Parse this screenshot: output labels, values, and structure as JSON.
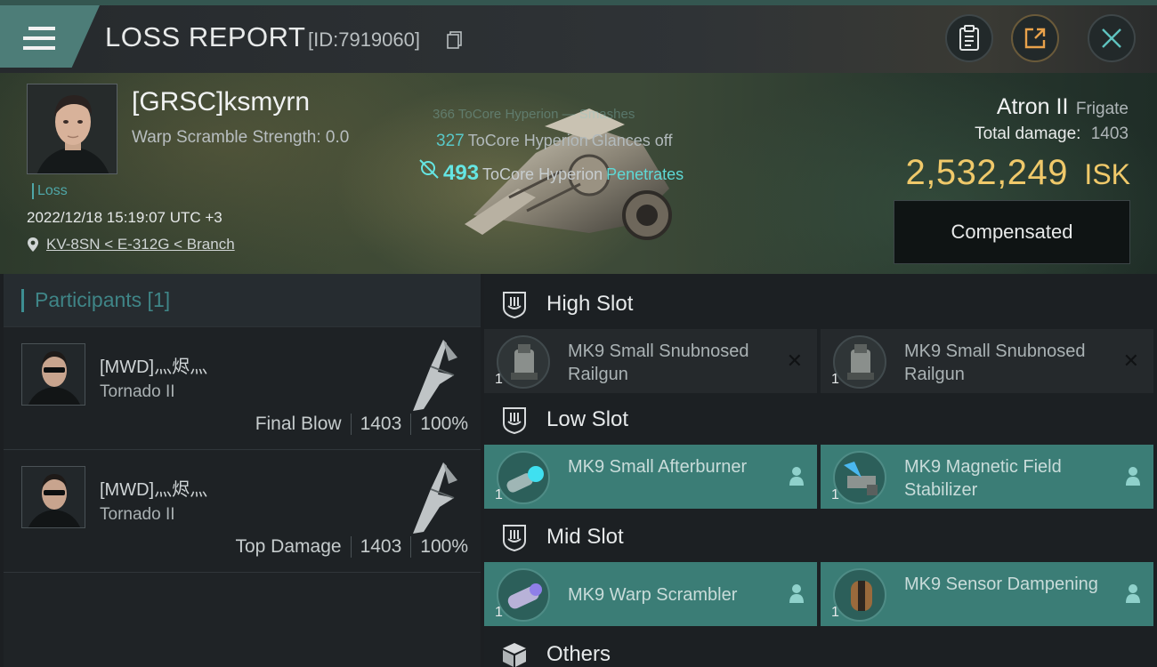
{
  "header": {
    "title": "LOSS REPORT",
    "id_text": "[ID:7919060]"
  },
  "victim": {
    "name": "[GRSC]ksmyrn",
    "warp_scramble": "Warp Scramble Strength: 0.0",
    "loss_tag": "Loss",
    "datetime": "2022/12/18 15:19:07 UTC +3",
    "location": "KV-8SN < E-312G < Branch"
  },
  "damage_feed": {
    "ghost": "366 ToCore Hyperion — Smashes",
    "line1": {
      "num": "327",
      "who": "ToCore Hyperion",
      "result": "Glances off"
    },
    "line2": {
      "num": "493",
      "who": "ToCore Hyperion",
      "result": "Penetrates"
    }
  },
  "ship": {
    "name": "Atron II",
    "class": "Frigate",
    "total_damage_label": "Total damage:",
    "total_damage_value": "1403",
    "isk_value": "2,532,249",
    "isk_unit": "ISK",
    "compensated_label": "Compensated"
  },
  "participants": {
    "header": "Participants [1]",
    "rows": [
      {
        "name": "[MWD]灬烬灬",
        "ship": "Tornado II",
        "role": "Final Blow",
        "damage": "1403",
        "percent": "100%"
      },
      {
        "name": "[MWD]灬烬灬",
        "ship": "Tornado II",
        "role": "Top Damage",
        "damage": "1403",
        "percent": "100%"
      }
    ]
  },
  "slots": {
    "high": {
      "label": "High Slot",
      "modules": [
        {
          "name": "MK9 Small Snubnosed Railgun",
          "qty": "1",
          "state": "destroyed"
        },
        {
          "name": "MK9 Small Snubnosed Railgun",
          "qty": "1",
          "state": "destroyed"
        }
      ]
    },
    "low": {
      "label": "Low Slot",
      "modules": [
        {
          "name": "MK9 Small Afterburner",
          "qty": "1",
          "state": "dropped"
        },
        {
          "name": "MK9 Magnetic Field Stabilizer",
          "qty": "1",
          "state": "dropped"
        }
      ]
    },
    "mid": {
      "label": "Mid Slot",
      "modules": [
        {
          "name": "MK9 Warp Scrambler",
          "qty": "1",
          "state": "dropped"
        },
        {
          "name": "MK9 Sensor Dampening",
          "qty": "1",
          "state": "dropped"
        }
      ]
    },
    "others": {
      "label": "Others"
    }
  },
  "colors": {
    "accent": "#3b7d76",
    "isk": "#f0c96a",
    "teal_text": "#59c8c7"
  },
  "icons": [
    "menu-icon",
    "copy-icon",
    "clipboard-icon",
    "share-icon",
    "close-icon",
    "location-pin-icon",
    "slot-icon",
    "box-icon",
    "person-icon"
  ]
}
